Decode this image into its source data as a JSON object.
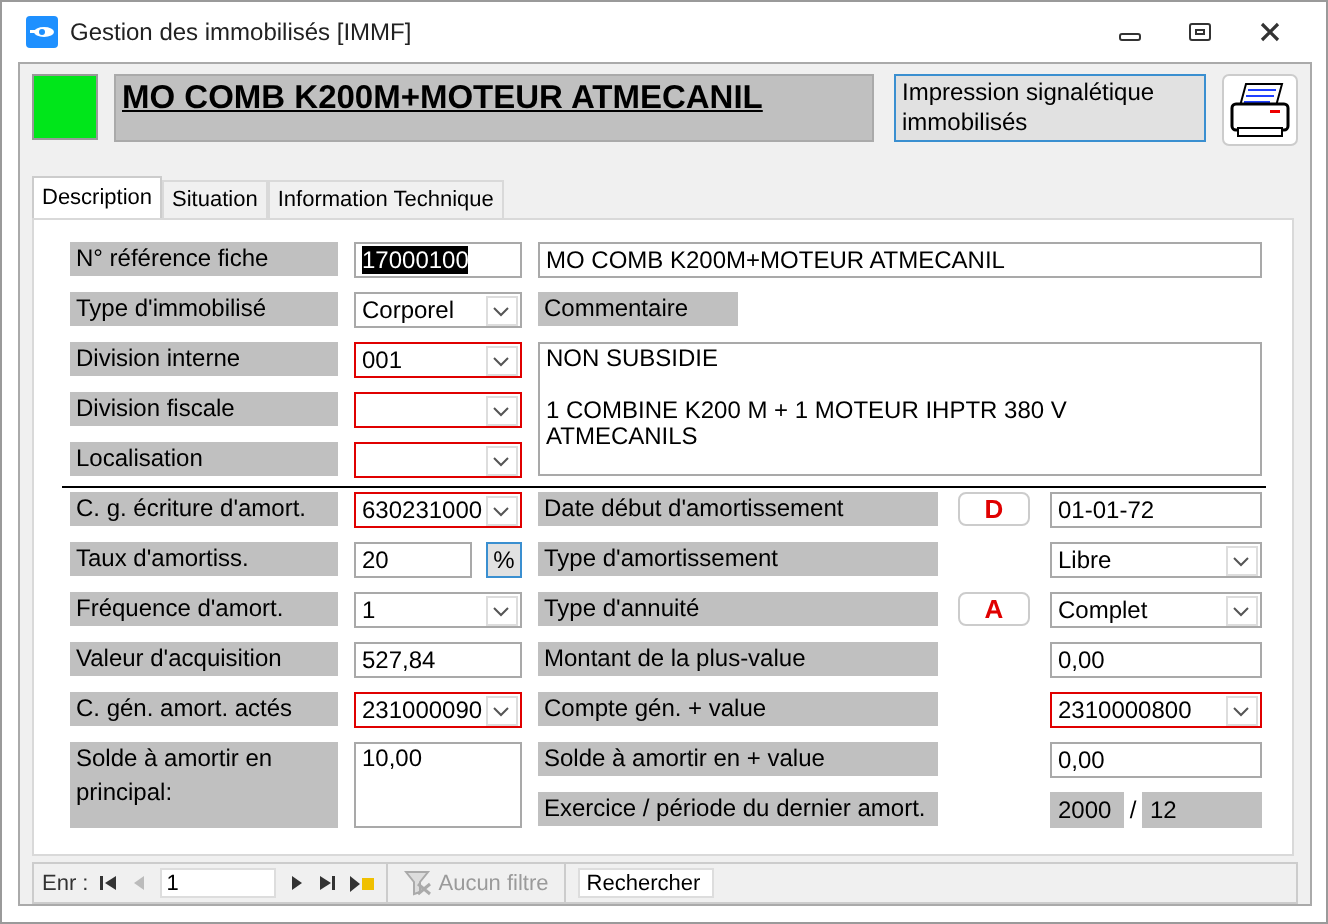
{
  "window": {
    "title": "Gestion des immobilisés [IMMF]"
  },
  "header": {
    "active": true,
    "title": "MO COMB K200M+MOTEUR ATMECANIL",
    "print_button": "Impression signalétique immobilisés"
  },
  "tabs": [
    {
      "label": "Description",
      "selected": true
    },
    {
      "label": "Situation",
      "selected": false
    },
    {
      "label": "Information Technique",
      "selected": false
    }
  ],
  "reference": {
    "label": "N° référence fiche",
    "value": "17000100",
    "selected": true,
    "designation": "MO COMB K200M+MOTEUR ATMECANIL"
  },
  "left_fields": [
    {
      "label": "Type d'immobilisé",
      "kind": "dropdown",
      "value": "Corporel",
      "required": false
    },
    {
      "label": "Division interne",
      "kind": "dropdown",
      "value": "001",
      "required": true
    },
    {
      "label": "Division fiscale",
      "kind": "dropdown",
      "required": true
    },
    {
      "label": "Localisation",
      "kind": "dropdown",
      "required": true
    }
  ],
  "comment": {
    "label": "Commentaire",
    "value": "NON SUBSIDIE\n\n1 COMBINE K200 M + 1 MOTEUR IHPTR 380 V\nATMECANILS"
  },
  "amort_left": [
    {
      "label": "C. g. écriture d'amort.",
      "kind": "dropdown",
      "value": "630231000",
      "required": true
    },
    {
      "label": "Taux d'amortiss.",
      "kind": "percent",
      "value": "20",
      "button": "%"
    },
    {
      "label": "Fréquence d'amort.",
      "kind": "dropdown",
      "value": "1",
      "required": false
    },
    {
      "label": "Valeur d'acquisition",
      "kind": "text",
      "value": "527,84"
    },
    {
      "label": "C. gén. amort. actés",
      "kind": "dropdown",
      "value": "231000090",
      "required": true
    },
    {
      "label": "Solde à amortir en principal:",
      "kind": "area",
      "value": "10,00"
    }
  ],
  "amort_right": [
    {
      "label": "Date début d'amortissement",
      "badge": "D",
      "kind": "text",
      "value": "01-01-72"
    },
    {
      "label": "Type d'amortissement",
      "kind": "dropdown",
      "value": "Libre",
      "required": false
    },
    {
      "label": "Type d'annuité",
      "badge": "A",
      "kind": "dropdown",
      "value": "Complet",
      "required": false
    },
    {
      "label": "Montant de la plus-value",
      "kind": "text",
      "value": "0,00"
    },
    {
      "label": "Compte gén. + value",
      "kind": "dropdown",
      "value": "2310000800",
      "required": true
    },
    {
      "label": "Solde à amortir en + value",
      "kind": "text",
      "value": "0,00"
    },
    {
      "label": "Exercice / période du dernier amort.",
      "kind": "period",
      "year": "2000",
      "separator": "/",
      "period": "12"
    }
  ],
  "status_bar": {
    "record_label": "Enr :",
    "record": "1",
    "filter": "Aucun filtre",
    "filter_disabled": true,
    "search_placeholder": "Rechercher"
  }
}
